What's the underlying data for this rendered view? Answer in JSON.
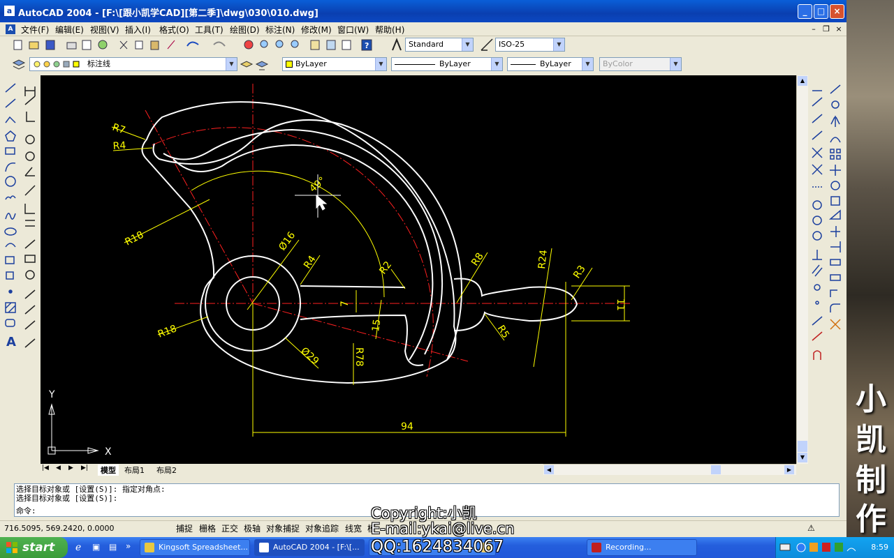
{
  "window": {
    "app_icon_letter": "a",
    "title": "AutoCAD 2004 - [F:\\[跟小凯学CAD][第二季]\\dwg\\030\\010.dwg]",
    "controls": {
      "minimize": "_",
      "maximize": "□",
      "close": "×"
    }
  },
  "menu": {
    "items": [
      "文件(F)",
      "编辑(E)",
      "视图(V)",
      "插入(I)",
      "格式(O)",
      "工具(T)",
      "绘图(D)",
      "标注(N)",
      "修改(M)",
      "窗口(W)",
      "帮助(H)"
    ],
    "doc_controls": [
      "–",
      "❐",
      "×"
    ]
  },
  "toolbar": {
    "text_style": "Standard",
    "dim_style": "ISO-25",
    "layer": "标注线",
    "color": "ByLayer",
    "linetype": "ByLayer",
    "lineweight": "ByLayer",
    "plotstyle": "ByColor"
  },
  "layout_tabs": [
    "模型",
    "布局1",
    "布局2"
  ],
  "drawing": {
    "dims": [
      "R7",
      "R4",
      "R18",
      "Ø16",
      "R4",
      "R18",
      "Ø29",
      "7",
      "15",
      "R2",
      "R78",
      "R8",
      "R24",
      "R3",
      "R5",
      "11",
      "94"
    ],
    "angle": "49°",
    "ucs_y": "Y",
    "ucs_x": "X"
  },
  "command": {
    "line1": "选择目标对象或 [设置(S)]: 指定对角点:",
    "line2": "选择目标对象或 [设置(S)]:",
    "prompt": "命令:"
  },
  "status": {
    "coords": "716.5095, 569.2420, 0.0000",
    "buttons": [
      "捕捉",
      "栅格",
      "正交",
      "极轴",
      "对象捕捉",
      "对象追踪",
      "线宽",
      "模"
    ]
  },
  "taskbar": {
    "start": "start",
    "tasks": [
      "Kingsoft Spreadsheet...",
      "AutoCAD 2004 - [F:\\[...",
      "030",
      "Recording..."
    ],
    "clock": "8:59"
  },
  "overlay": {
    "copyright": "Copyright:小凯",
    "email": "E-mail:ykai@live.cn",
    "qq": "QQ:1624834067"
  },
  "banner": [
    "小",
    "凯",
    "制",
    "作"
  ],
  "colors": {
    "canvas": "#000000",
    "outline": "#FFFFFF",
    "center_line": "#FF0000",
    "dimension": "#FFFF00",
    "titlebar": "#0A3FB0"
  }
}
